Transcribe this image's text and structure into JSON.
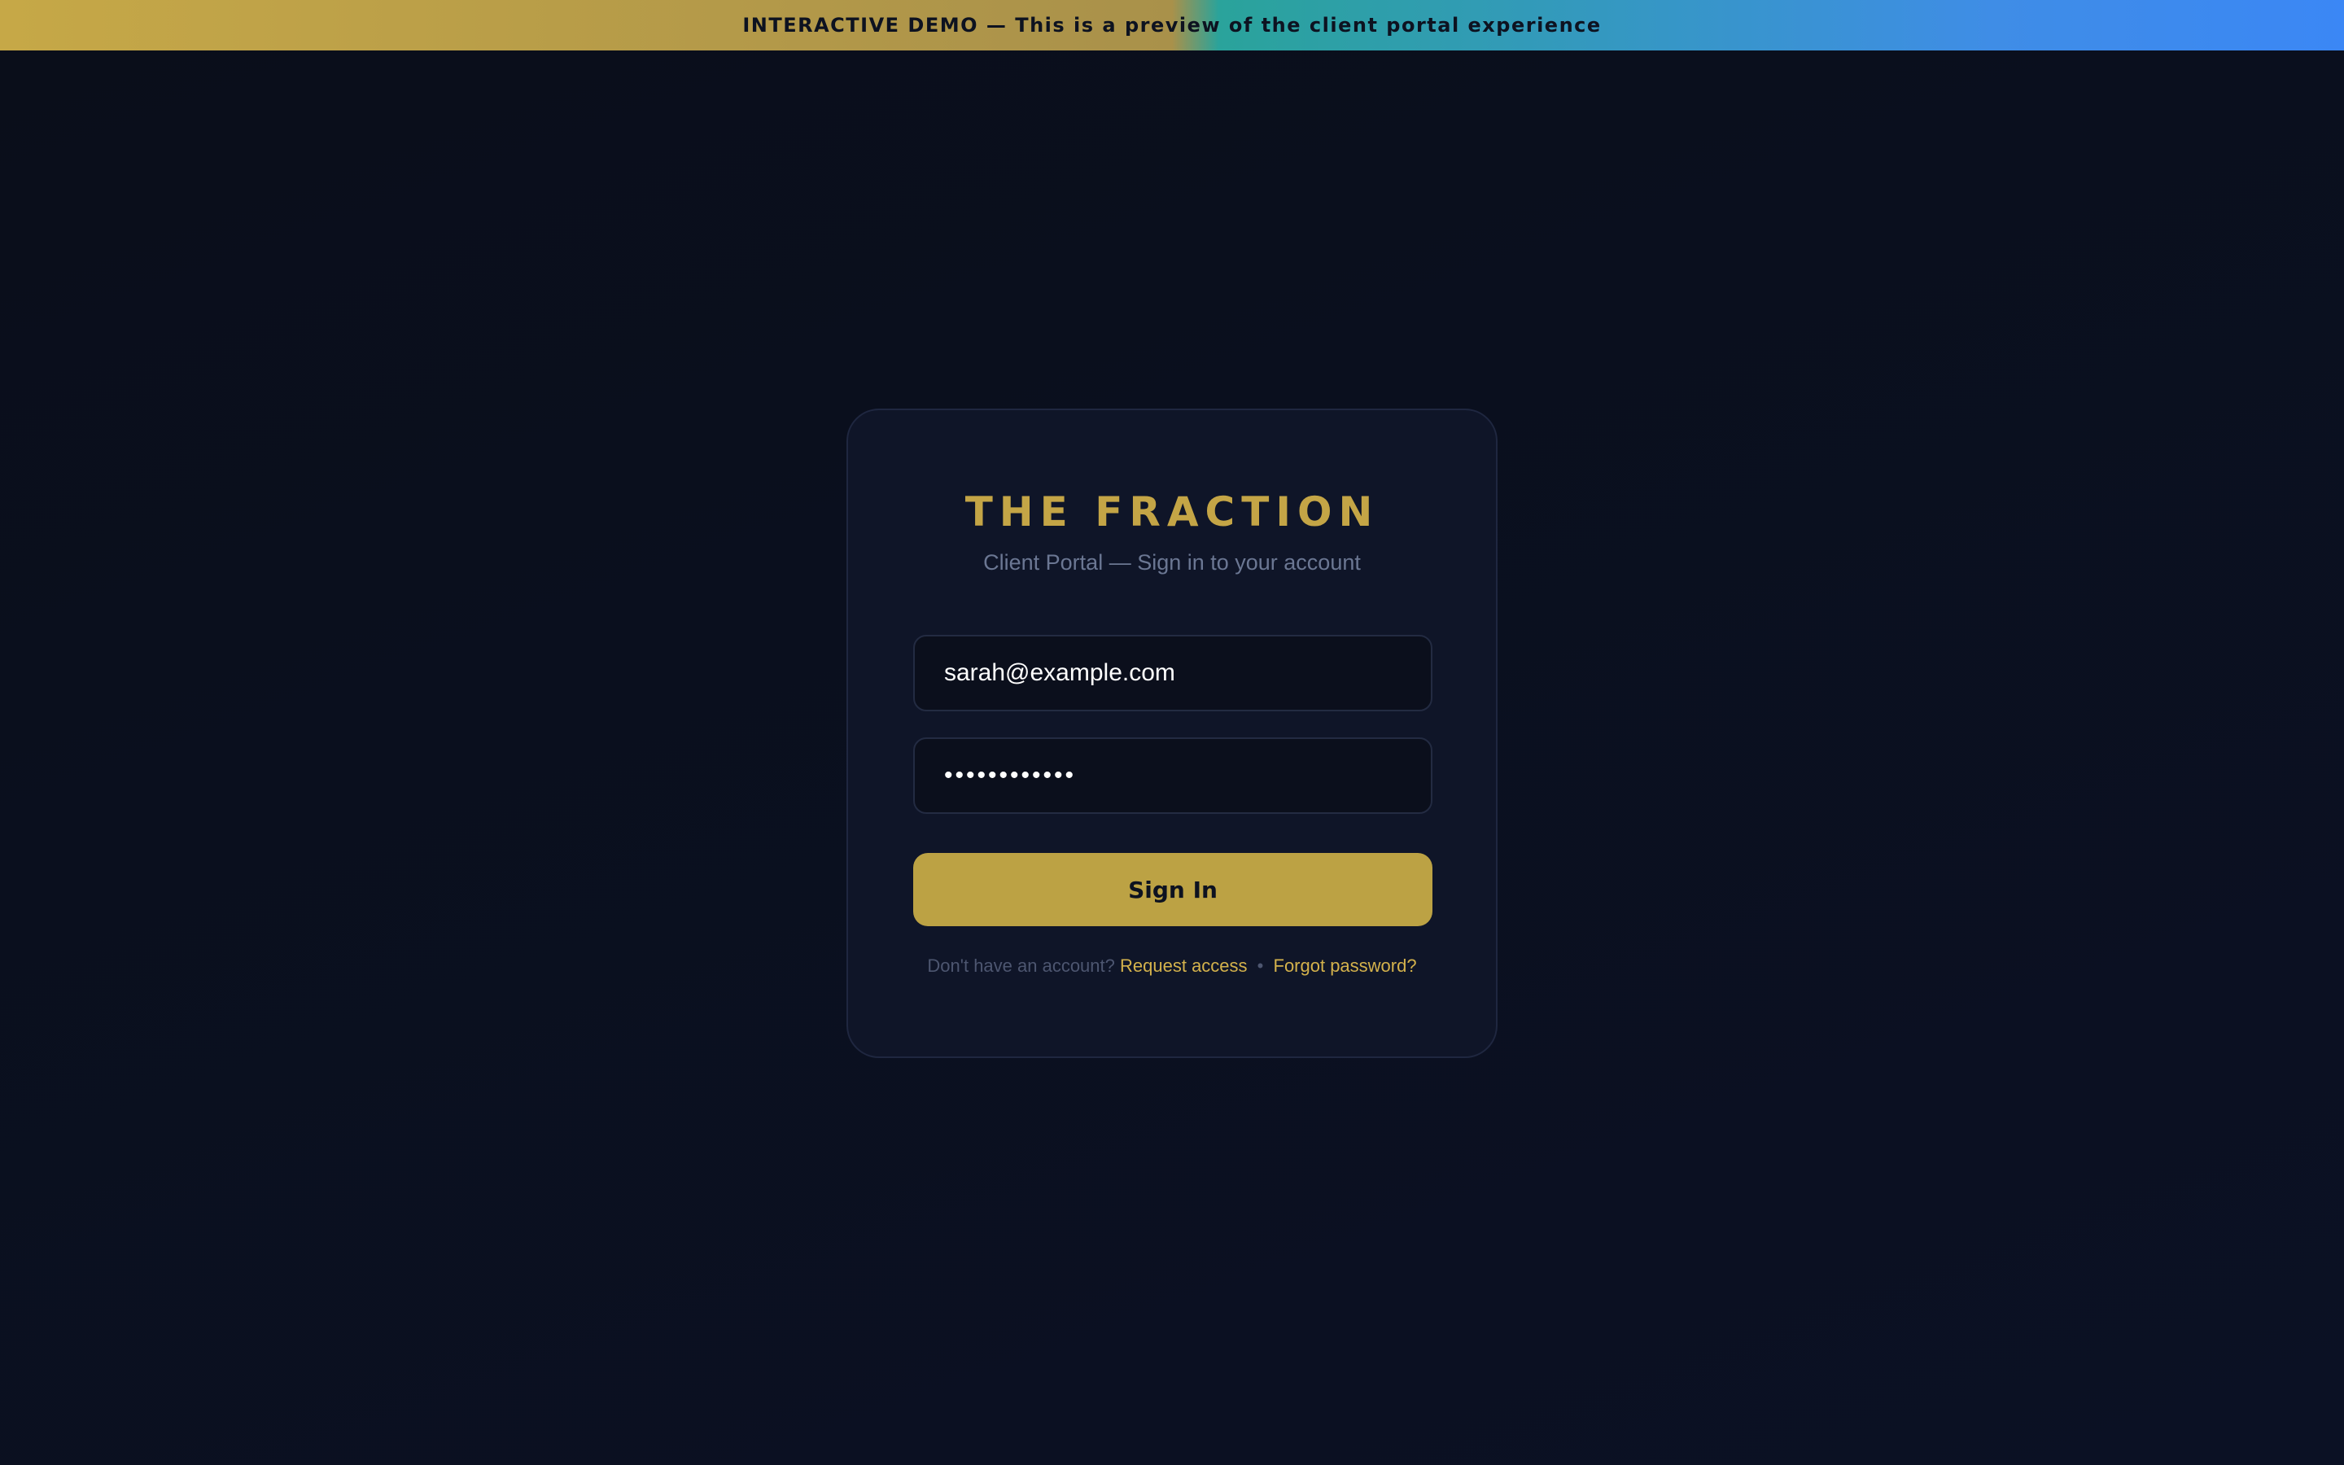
{
  "banner": {
    "text": "INTERACTIVE DEMO — This is a preview of the client portal experience"
  },
  "login": {
    "brand": "THE FRACTION",
    "subtitle": "Client Portal — Sign in to your account",
    "email_value": "sarah@example.com",
    "password_value": "••••••••••••",
    "signin_label": "Sign In",
    "footer_prompt": "Don't have an account?",
    "request_access_label": "Request access",
    "separator": "•",
    "forgot_password_label": "Forgot password?"
  },
  "colors": {
    "accent_gold": "#c4a546",
    "banner_blue": "#3b87f5",
    "background": "#0a0e1a",
    "card": "#0f1528"
  }
}
